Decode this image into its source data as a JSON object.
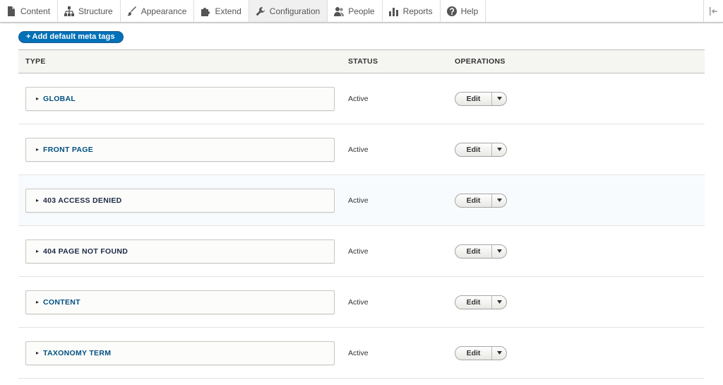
{
  "toolbar": {
    "tabs": [
      {
        "label": "Content",
        "icon": "file-icon"
      },
      {
        "label": "Structure",
        "icon": "sitemap-icon"
      },
      {
        "label": "Appearance",
        "icon": "paintbrush-icon"
      },
      {
        "label": "Extend",
        "icon": "puzzle-icon"
      },
      {
        "label": "Configuration",
        "icon": "wrench-icon"
      },
      {
        "label": "People",
        "icon": "people-icon"
      },
      {
        "label": "Reports",
        "icon": "bar-chart-icon"
      },
      {
        "label": "Help",
        "icon": "help-icon"
      }
    ],
    "active": "Configuration"
  },
  "actions": {
    "add_plus": "+",
    "add_label": "Add default meta tags"
  },
  "table": {
    "headers": {
      "type": "TYPE",
      "status": "STATUS",
      "operations": "OPERATIONS"
    },
    "rows": [
      {
        "type": "GLOBAL",
        "status": "Active",
        "operation": "Edit"
      },
      {
        "type": "FRONT PAGE",
        "status": "Active",
        "operation": "Edit"
      },
      {
        "type": "403 ACCESS DENIED",
        "status": "Active",
        "operation": "Edit"
      },
      {
        "type": "404 PAGE NOT FOUND",
        "status": "Active",
        "operation": "Edit"
      },
      {
        "type": "CONTENT",
        "status": "Active",
        "operation": "Edit"
      },
      {
        "type": "TAXONOMY TERM",
        "status": "Active",
        "operation": "Edit"
      }
    ],
    "collapsed_arrow": "▸"
  },
  "colors": {
    "accent": "#0071b8",
    "link": "#004f80",
    "header_bg": "#f5f5f2",
    "highlight_row": "#f7fbfe"
  }
}
